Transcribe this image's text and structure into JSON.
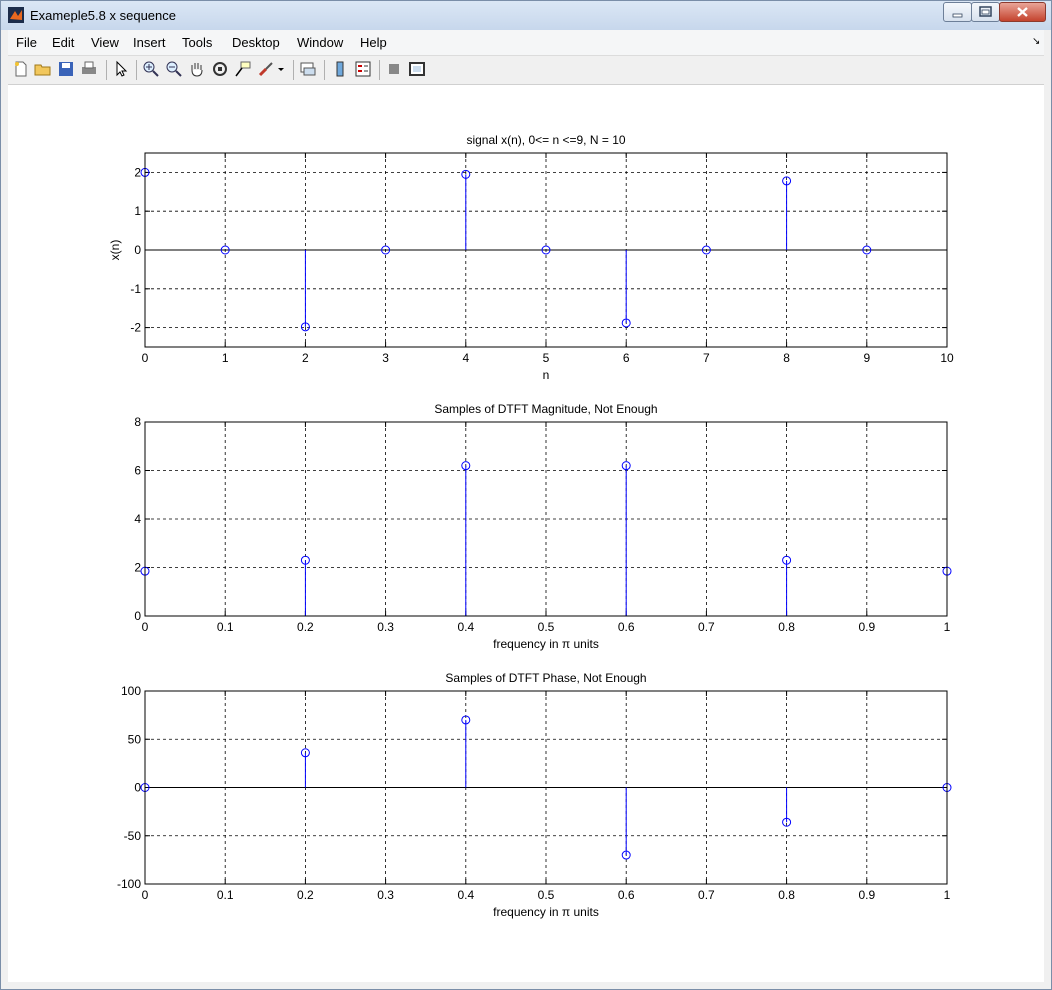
{
  "window": {
    "title": "Exameple5.8 x sequence"
  },
  "menu": {
    "items": [
      "File",
      "Edit",
      "View",
      "Insert",
      "Tools",
      "Desktop",
      "Window",
      "Help"
    ]
  },
  "toolbar": {
    "icons": [
      "new-figure-icon",
      "open-file-icon",
      "save-icon",
      "print-icon",
      "pointer-icon",
      "zoom-in-icon",
      "zoom-out-icon",
      "pan-hand-icon",
      "rotate-3d-icon",
      "data-cursor-icon",
      "brush-icon",
      "brush-dropdown-icon",
      "link-plot-icon",
      "colorbar-icon",
      "legend-icon",
      "hide-plot-tools-icon",
      "show-plot-tools-icon"
    ]
  },
  "colors": {
    "stem": "#0000ff",
    "axis": "#000000",
    "background": "#ffffff"
  },
  "chart_data": [
    {
      "type": "stem",
      "title": "signal x(n), 0<= n <=9, N = 10",
      "xlabel": "n",
      "ylabel": "x(n)",
      "xlim": [
        0,
        10
      ],
      "ylim": [
        -2.5,
        2.5
      ],
      "xticks": [
        0,
        1,
        2,
        3,
        4,
        5,
        6,
        7,
        8,
        9,
        10
      ],
      "yticks": [
        -2,
        -1,
        0,
        1,
        2
      ],
      "xtick_labels": [
        "0",
        "1",
        "2",
        "3",
        "4",
        "5",
        "6",
        "7",
        "8",
        "9",
        "10"
      ],
      "ytick_labels": [
        "-2",
        "-1",
        "0",
        "1",
        "2"
      ],
      "grid": true,
      "x": [
        0,
        1,
        2,
        3,
        4,
        5,
        6,
        7,
        8,
        9
      ],
      "y": [
        2,
        0,
        -1.98,
        0,
        1.95,
        0,
        -1.88,
        0,
        1.78,
        0
      ]
    },
    {
      "type": "stem",
      "title": "Samples of DTFT Magnitude, Not Enough",
      "xlabel": "frequency in π units",
      "ylabel": "",
      "xlim": [
        0,
        1
      ],
      "ylim": [
        0,
        8
      ],
      "xticks": [
        0,
        0.1,
        0.2,
        0.3,
        0.4,
        0.5,
        0.6,
        0.7,
        0.8,
        0.9,
        1
      ],
      "yticks": [
        0,
        2,
        4,
        6,
        8
      ],
      "xtick_labels": [
        "0",
        "0.1",
        "0.2",
        "0.3",
        "0.4",
        "0.5",
        "0.6",
        "0.7",
        "0.8",
        "0.9",
        "1"
      ],
      "ytick_labels": [
        "0",
        "2",
        "4",
        "6",
        "8"
      ],
      "grid": true,
      "x": [
        0,
        0.2,
        0.4,
        0.6,
        0.8,
        1
      ],
      "y": [
        1.85,
        2.3,
        6.2,
        6.2,
        2.3,
        1.85
      ]
    },
    {
      "type": "stem",
      "title": "Samples of DTFT Phase, Not Enough",
      "xlabel": "frequency in π units",
      "ylabel": "",
      "xlim": [
        0,
        1
      ],
      "ylim": [
        -100,
        100
      ],
      "xticks": [
        0,
        0.1,
        0.2,
        0.3,
        0.4,
        0.5,
        0.6,
        0.7,
        0.8,
        0.9,
        1
      ],
      "yticks": [
        -100,
        -50,
        0,
        50,
        100
      ],
      "xtick_labels": [
        "0",
        "0.1",
        "0.2",
        "0.3",
        "0.4",
        "0.5",
        "0.6",
        "0.7",
        "0.8",
        "0.9",
        "1"
      ],
      "ytick_labels": [
        "-100",
        "-50",
        "0",
        "50",
        "100"
      ],
      "grid": true,
      "x": [
        0,
        0.2,
        0.4,
        0.6,
        0.8,
        1
      ],
      "y": [
        0,
        36,
        70,
        -70,
        -36,
        0
      ]
    }
  ]
}
